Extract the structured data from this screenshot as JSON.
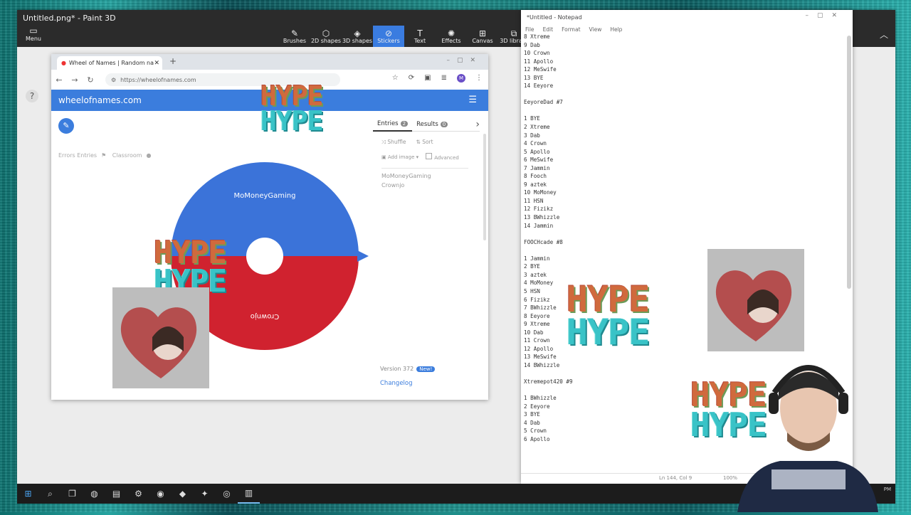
{
  "paint": {
    "title": "Untitled.png* - Paint 3D",
    "menu_label": "Menu",
    "tools": [
      {
        "label": "Brushes",
        "icon": "brush-icon",
        "glyph": "✎"
      },
      {
        "label": "2D shapes",
        "icon": "shapes-2d-icon",
        "glyph": "⬡"
      },
      {
        "label": "3D shapes",
        "icon": "shapes-3d-icon",
        "glyph": "◈"
      },
      {
        "label": "Stickers",
        "icon": "stickers-icon",
        "glyph": "⊘"
      },
      {
        "label": "Text",
        "icon": "text-icon",
        "glyph": "T"
      },
      {
        "label": "Effects",
        "icon": "effects-icon",
        "glyph": "✺"
      },
      {
        "label": "Canvas",
        "icon": "canvas-icon",
        "glyph": "⊞"
      },
      {
        "label": "3D library",
        "icon": "library-3d-icon",
        "glyph": "⧉"
      }
    ],
    "active_tool": "Stickers",
    "accent": "#3a7ce0"
  },
  "chrome": {
    "tab_title": "Wheel of Names | Random na",
    "url": "https://wheelofnames.com"
  },
  "won": {
    "brand": "wheelofnames.com",
    "caption_left": "Errors Entries",
    "caption_right": "Classroom",
    "tabs": {
      "entries": "Entries",
      "entries_count": "2",
      "results": "Results",
      "results_count": "0"
    },
    "actions": {
      "shuffle": "Shuffle",
      "sort": "Sort",
      "add_image": "Add image",
      "advanced": "Advanced"
    },
    "entries": [
      "MoMoneyGaming",
      "Crownjo"
    ],
    "wheel": {
      "slices": [
        {
          "label": "MoMoneyGaming",
          "color": "#3b73d9"
        },
        {
          "label": "Crownjo",
          "color": "#d0222f"
        }
      ]
    },
    "version": "Version 372",
    "new_badge": "New!",
    "changelog": "Changelog"
  },
  "notepad": {
    "title": "*Untitled - Notepad",
    "menu": [
      "File",
      "Edit",
      "Format",
      "View",
      "Help"
    ],
    "lines": [
      "8 Xtreme",
      "9 Dab",
      "10 Crown",
      "11 Apollo",
      "12 MeSwife",
      "13 BYE",
      "14 Eeyore",
      "",
      "EeyoreDad #7",
      "",
      "1 BYE",
      "2 Xtreme",
      "3 Dab",
      "4 Crown",
      "5 Apollo",
      "6 MeSwife",
      "7 Jammin",
      "8 Fooch",
      "9 aztek",
      "10 MoMoney",
      "11 HSN",
      "12 Fizikz",
      "13 BWhizzle",
      "14 Jammin",
      "",
      "FOOCHcade #8",
      "",
      "1 Jammin",
      "2 BYE",
      "3 aztek",
      "4 MoMoney",
      "5 HSN",
      "6 Fizikz",
      "7 BWhizzle",
      "8 Eeyore",
      "9 Xtreme",
      "10 Dab",
      "11 Crown",
      "12 Apollo",
      "13 MeSwife",
      "14 BWhizzle",
      "",
      "Xtremepot420 #9",
      "",
      "1 BWhizzle",
      "2 Eeyore",
      "3 BYE",
      "4 Dab",
      "5 Crown",
      "6 Apollo"
    ],
    "status_pos": "Ln 144, Col 9",
    "status_zoom": "100%"
  },
  "overlay": {
    "hype": "HYPE"
  },
  "taskbar": {
    "items": [
      "start-icon",
      "search-icon",
      "task-view-icon",
      "edge-icon",
      "file-explorer-icon",
      "settings-icon",
      "chrome-icon",
      "app-icon",
      "paint3d-icon",
      "obs-icon",
      "notepad-icon"
    ],
    "time": "PM"
  }
}
